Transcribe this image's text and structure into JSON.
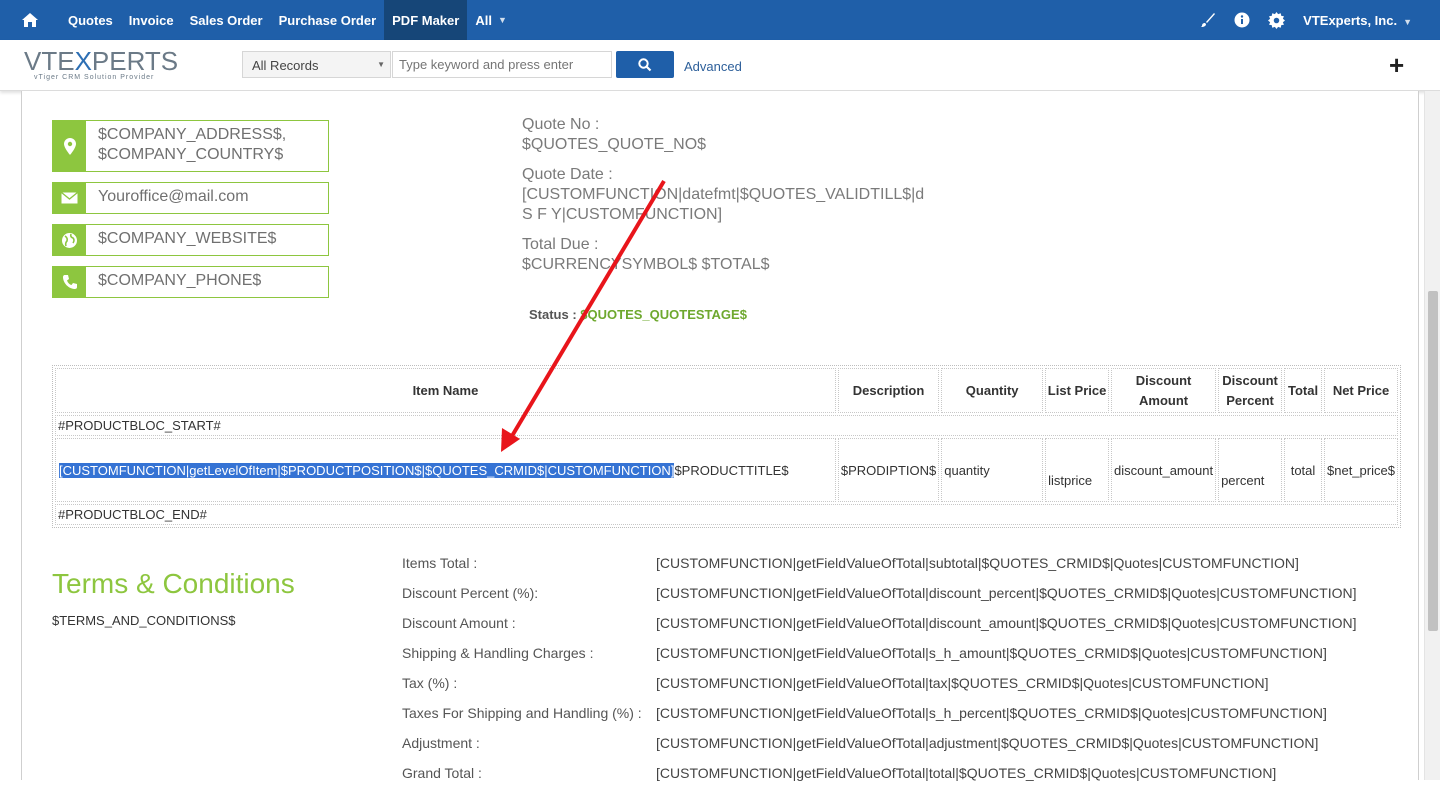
{
  "nav": {
    "items": [
      {
        "label": "Quotes"
      },
      {
        "label": "Invoice"
      },
      {
        "label": "Sales Order"
      },
      {
        "label": "Purchase Order"
      },
      {
        "label": "PDF Maker"
      },
      {
        "label": "All"
      }
    ],
    "active": "PDF Maker",
    "user": "VTExperts, Inc."
  },
  "logo": {
    "part1": "VTE",
    "part2": "X",
    "part3": "PERTS",
    "tagline": "vTiger CRM Solution Provider"
  },
  "search": {
    "filter_value": "All Records",
    "placeholder": "Type keyword and press enter",
    "advanced_label": "Advanced"
  },
  "contact": {
    "address_line1": "$COMPANY_ADDRESS$,",
    "address_line2": "$COMPANY_COUNTRY$",
    "email": "Youroffice@mail.com",
    "website": "$COMPANY_WEBSITE$",
    "phone": "$COMPANY_PHONE$"
  },
  "quote_info": {
    "quote_no_label": "Quote No :",
    "quote_no_value": "$QUOTES_QUOTE_NO$",
    "quote_date_label": "Quote Date :",
    "quote_date_value1": "[CUSTOMFUNCTION|datefmt|$QUOTES_VALIDTILL$|d",
    "quote_date_value2": "S F Y|CUSTOMFUNCTION]",
    "total_due_label": "Total Due :",
    "total_due_value": "$CURRENCYSYMBOL$ $TOTAL$",
    "status_label": "Status :",
    "status_value": "$QUOTES_QUOTESTAGE$"
  },
  "items_table": {
    "headers": [
      "Item Name",
      "Description",
      "Quantity",
      "List Price",
      "Discount Amount",
      "Discount Percent",
      "Total",
      "Net Price"
    ],
    "bloc_start": "#PRODUCTBLOC_START#",
    "row": {
      "item_highlight": "[CUSTOMFUNCTION|getLevelOfItem|$PRODUCTPOSITION$|$QUOTES_CRMID$|CUSTOMFUNCTION]",
      "item_title": "$PRODUCTTITLE$",
      "description": "$PRODIPTION$",
      "quantity": "quantity",
      "list_price": "listprice",
      "discount_amount": "discount_amount",
      "discount_percent": "percent",
      "total": "total",
      "net_price": "$net_price$"
    },
    "bloc_end": "#PRODUCTBLOC_END#"
  },
  "terms": {
    "title": "Terms & Conditions",
    "text": "$TERMS_AND_CONDITIONS$"
  },
  "totals": [
    {
      "label": "Items Total :",
      "value": "[CUSTOMFUNCTION|getFieldValueOfTotal|subtotal|$QUOTES_CRMID$|Quotes|CUSTOMFUNCTION]"
    },
    {
      "label": "Discount Percent (%):",
      "value": "[CUSTOMFUNCTION|getFieldValueOfTotal|discount_percent|$QUOTES_CRMID$|Quotes|CUSTOMFUNCTION]"
    },
    {
      "label": "Discount Amount :",
      "value": "[CUSTOMFUNCTION|getFieldValueOfTotal|discount_amount|$QUOTES_CRMID$|Quotes|CUSTOMFUNCTION]"
    },
    {
      "label": "Shipping & Handling Charges :",
      "value": "[CUSTOMFUNCTION|getFieldValueOfTotal|s_h_amount|$QUOTES_CRMID$|Quotes|CUSTOMFUNCTION]"
    },
    {
      "label": "Tax (%) :",
      "value": "[CUSTOMFUNCTION|getFieldValueOfTotal|tax|$QUOTES_CRMID$|Quotes|CUSTOMFUNCTION]"
    },
    {
      "label": "Taxes For Shipping and Handling (%) :",
      "value": "[CUSTOMFUNCTION|getFieldValueOfTotal|s_h_percent|$QUOTES_CRMID$|Quotes|CUSTOMFUNCTION]"
    },
    {
      "label": "Adjustment :",
      "value": "[CUSTOMFUNCTION|getFieldValueOfTotal|adjustment|$QUOTES_CRMID$|Quotes|CUSTOMFUNCTION]"
    },
    {
      "label": "Grand Total :",
      "value": "[CUSTOMFUNCTION|getFieldValueOfTotal|total|$QUOTES_CRMID$|Quotes|CUSTOMFUNCTION]"
    }
  ],
  "colors": {
    "nav_bg": "#1f5fa9",
    "nav_active": "#164678",
    "accent_green": "#8dc63f",
    "highlight": "#3573d4",
    "arrow": "#e8151b"
  }
}
